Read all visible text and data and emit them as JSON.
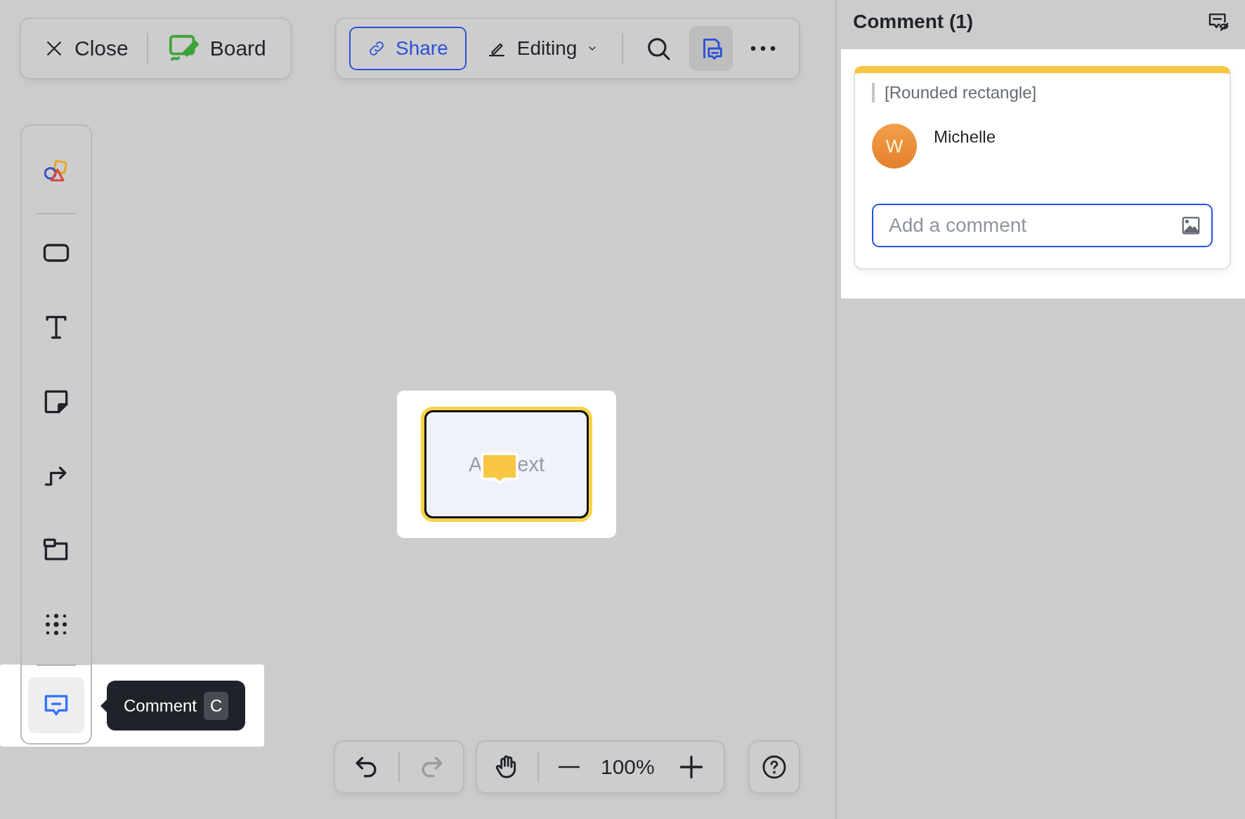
{
  "top_bar": {
    "close": "Close",
    "board": "Board",
    "share": "Share",
    "mode": "Editing",
    "comment_view_active": true
  },
  "tool_groups": [
    [
      {
        "kind": "shapes",
        "selected": false
      }
    ],
    [
      {
        "kind": "rectangle",
        "selected": false
      },
      {
        "kind": "text",
        "selected": false
      },
      {
        "kind": "sticky",
        "selected": false
      },
      {
        "kind": "connector",
        "selected": false
      },
      {
        "kind": "frame",
        "selected": false
      },
      {
        "kind": "more",
        "selected": false
      }
    ],
    [
      {
        "kind": "comment",
        "selected": true
      }
    ]
  ],
  "tooltip": {
    "label": "Comment",
    "shortcut": "C"
  },
  "canvas_shape": {
    "text_before": "A",
    "text_after": "ext",
    "highlighted": true
  },
  "bottom_bar": {
    "redo_disabled": true,
    "zoom": "100%"
  },
  "panel": {
    "title": "Comment (1)",
    "card": {
      "target": "[Rounded rectangle]",
      "author": "Michelle",
      "avatar_letter": "W",
      "placeholder": "Add a comment"
    }
  }
}
